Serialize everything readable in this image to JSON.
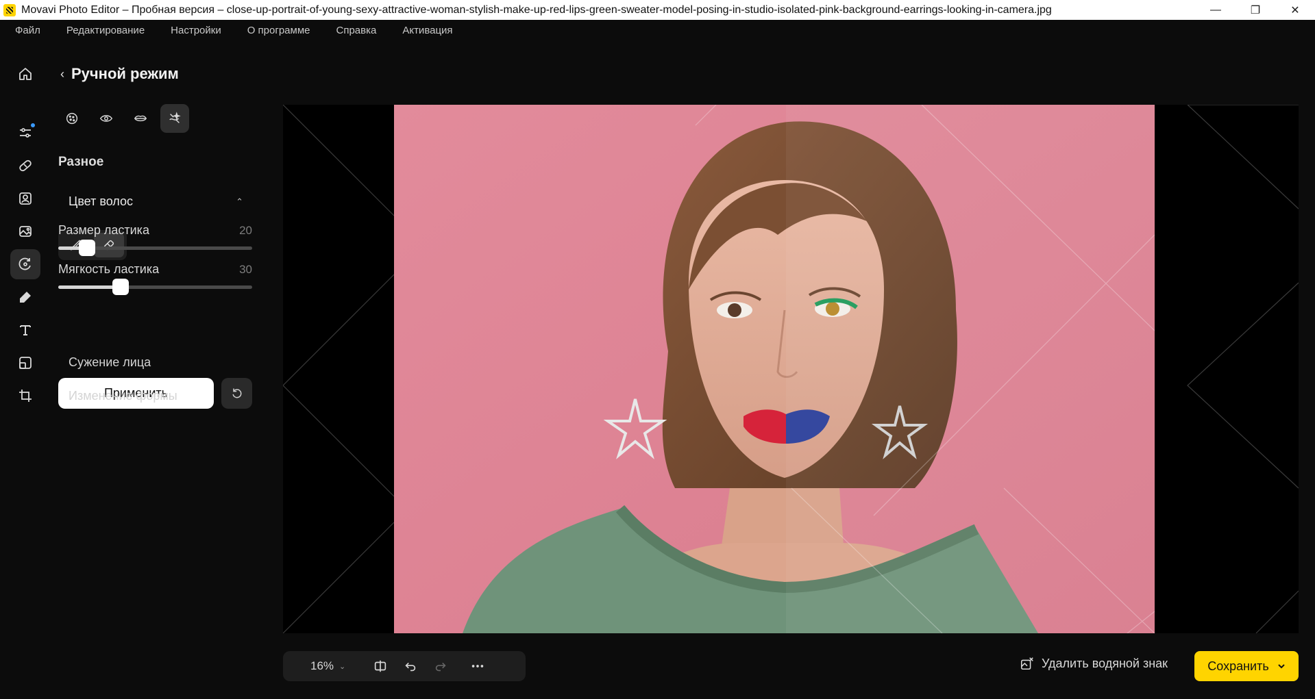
{
  "window": {
    "title": "Movavi Photo Editor – Пробная версия – close-up-portrait-of-young-sexy-attractive-woman-stylish-make-up-red-lips-green-sweater-model-posing-in-studio-isolated-pink-background-earrings-looking-in-camera.jpg",
    "minimize_glyph": "—",
    "maximize_glyph": "❐",
    "close_glyph": "✕"
  },
  "menu": [
    "Файл",
    "Редактирование",
    "Настройки",
    "О программе",
    "Справка",
    "Активация"
  ],
  "rail": {
    "items": [
      {
        "icon": "home-icon"
      },
      {
        "icon": "adjust-icon",
        "badge": true
      },
      {
        "icon": "retouch-icon"
      },
      {
        "icon": "portrait-icon"
      },
      {
        "icon": "image-icon"
      },
      {
        "icon": "transform-icon",
        "active": true
      },
      {
        "icon": "magic-icon"
      },
      {
        "icon": "text-icon"
      },
      {
        "icon": "frame-icon"
      },
      {
        "icon": "crop-icon"
      }
    ]
  },
  "panel": {
    "back_glyph": "‹",
    "title": "Ручной режим",
    "tools": [
      {
        "icon": "skin-icon"
      },
      {
        "icon": "eye-icon"
      },
      {
        "icon": "lips-icon"
      },
      {
        "icon": "misc-icon",
        "active": true
      }
    ],
    "section": "Разное",
    "accordion": {
      "label": "Цвет волос",
      "chevron": "⌃"
    },
    "brush_modes": [
      {
        "icon": "brush-icon"
      },
      {
        "icon": "eraser-icon",
        "active": true
      }
    ],
    "eraser_size": {
      "label": "Размер ластика",
      "value": "20",
      "fraction": 0.15
    },
    "eraser_softness": {
      "label": "Мягкость ластика",
      "value": "30",
      "fraction": 0.32
    },
    "apply_label": "Применить",
    "sub_items": [
      "Сужение лица",
      "Изменение формы"
    ]
  },
  "colors": {
    "accent": "#ffd400",
    "background": "#0c0c0c",
    "photo_bg": "#e08797"
  },
  "bottom": {
    "zoom": "16%",
    "zoom_chevron": "⌄",
    "watermark_label": "Удалить водяной знак",
    "save_label": "Сохранить"
  }
}
